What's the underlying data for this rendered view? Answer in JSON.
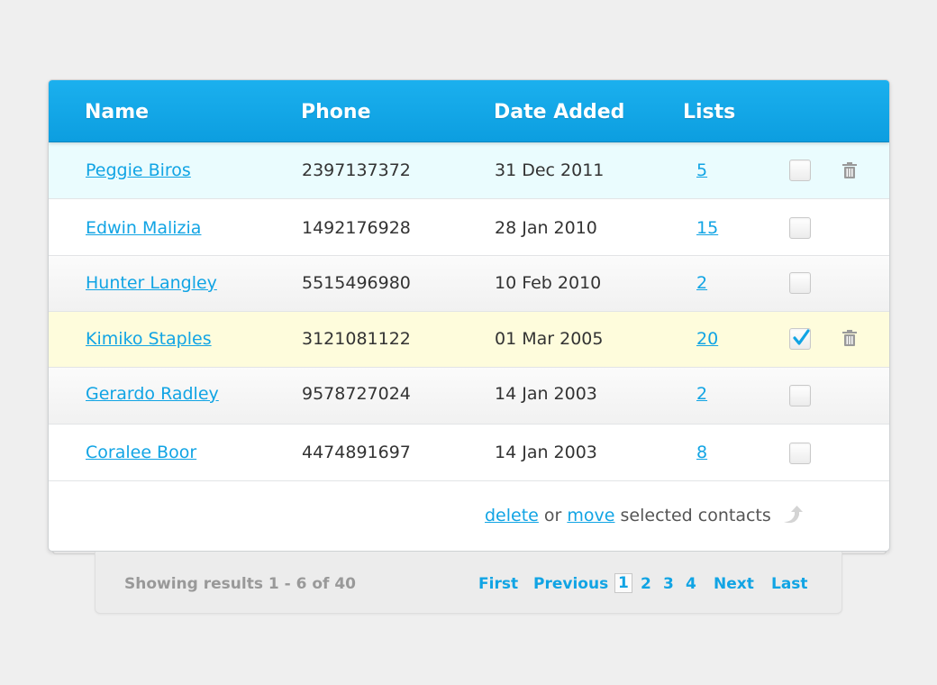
{
  "table": {
    "headers": {
      "name": "Name",
      "phone": "Phone",
      "date_added": "Date Added",
      "lists": "Lists"
    },
    "rows": [
      {
        "name": "Peggie Biros",
        "phone": "2397137372",
        "date": "31 Dec 2011",
        "lists": "5",
        "checked": false,
        "show_delete": true,
        "state": "hover"
      },
      {
        "name": "Edwin Malizia",
        "phone": "1492176928",
        "date": "28 Jan 2010",
        "lists": "15",
        "checked": false,
        "show_delete": false,
        "state": "normal"
      },
      {
        "name": "Hunter Langley",
        "phone": "5515496980",
        "date": "10 Feb 2010",
        "lists": "2",
        "checked": false,
        "show_delete": false,
        "state": "normal"
      },
      {
        "name": "Kimiko Staples",
        "phone": "3121081122",
        "date": "01 Mar 2005",
        "lists": "20",
        "checked": true,
        "show_delete": true,
        "state": "selected"
      },
      {
        "name": "Gerardo Radley",
        "phone": "9578727024",
        "date": "14 Jan 2003",
        "lists": "2",
        "checked": false,
        "show_delete": false,
        "state": "normal"
      },
      {
        "name": "Coralee Boor",
        "phone": "4474891697",
        "date": "14 Jan 2003",
        "lists": "8",
        "checked": false,
        "show_delete": false,
        "state": "normal"
      }
    ]
  },
  "actions": {
    "delete_label": "delete",
    "or_text": "or",
    "move_label": "move",
    "suffix_text": "selected contacts",
    "icon": "move-arrow-icon"
  },
  "pagination": {
    "results_text": "Showing results 1 - 6 of 40",
    "first": "First",
    "previous": "Previous",
    "pages": [
      "1",
      "2",
      "3",
      "4"
    ],
    "current_page": "1",
    "next": "Next",
    "last": "Last"
  },
  "colors": {
    "accent": "#11a4e4",
    "header_bg": "#0c9ee0",
    "hover_row": "#eafcfe",
    "selected_row": "#fefcdc"
  }
}
